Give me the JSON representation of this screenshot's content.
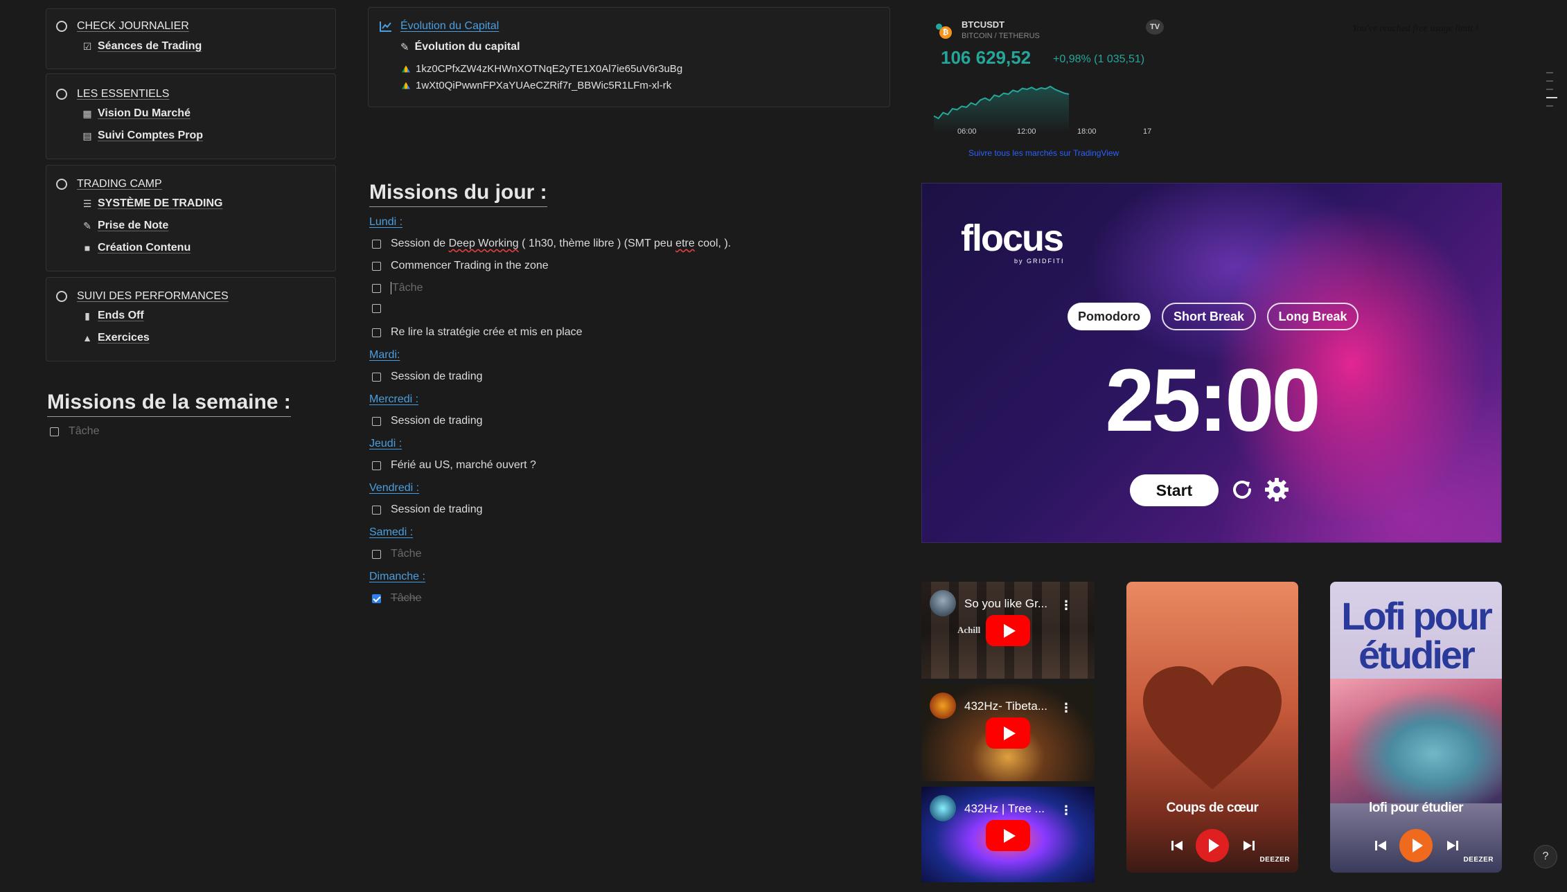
{
  "left_nav": {
    "sections": [
      {
        "title": "CHECK JOURNALIER",
        "items": [
          {
            "icon": "checkbox-icon",
            "label": "Séances de Trading"
          }
        ]
      },
      {
        "title": "LES ESSENTIELS",
        "items": [
          {
            "icon": "calendar-icon",
            "label": "Vision Du Marché"
          },
          {
            "icon": "calculator-icon",
            "label": "Suivi Comptes Prop"
          }
        ]
      },
      {
        "title": "TRADING CAMP",
        "items": [
          {
            "icon": "list-icon",
            "label": "SYSTÈME DE TRADING"
          },
          {
            "icon": "pencil-icon",
            "label": "Prise de Note"
          },
          {
            "icon": "video-icon",
            "label": "Création Contenu"
          }
        ]
      },
      {
        "title": "SUIVI DES PERFORMANCES",
        "items": [
          {
            "icon": "book-icon",
            "label": "Ends Off"
          },
          {
            "icon": "graduation-icon",
            "label": "Exercices"
          }
        ]
      }
    ]
  },
  "weekly": {
    "heading": "Missions de la semaine :",
    "task": "Tâche"
  },
  "capital": {
    "title": "Évolution du Capital",
    "subtitle": "Évolution du capital",
    "files": [
      "1kz0CPfxZW4zKHWnXOTNqE2yTE1X0Al7ie65uV6r3uBg",
      "1wXt0QiPwwnFPXaYUAeCZRif7r_BBWic5R1LFm-xl-rk"
    ]
  },
  "daily": {
    "heading": "Missions du jour :",
    "days": [
      {
        "name": "Lundi :",
        "tasks": [
          {
            "text_a": "Session de ",
            "text_b": "Deep Working",
            "text_c": " ( 1h30, thème libre ) (SMT peu ",
            "text_d": "etre",
            "text_e": " cool, ).",
            "state": "open"
          },
          {
            "text": "Commencer Trading in the zone",
            "state": "open"
          },
          {
            "text": "Tâche",
            "state": "placeholder"
          },
          {
            "text": "",
            "state": "open"
          },
          {
            "text": "Re lire la stratégie crée et mis en place",
            "state": "open"
          }
        ]
      },
      {
        "name": "Mardi:",
        "tasks": [
          {
            "text": "Session de trading",
            "state": "open"
          }
        ]
      },
      {
        "name": "Mercredi :",
        "tasks": [
          {
            "text": "Session de trading",
            "state": "open"
          }
        ]
      },
      {
        "name": "Jeudi :",
        "tasks": [
          {
            "text": "Férié au US, marché ouvert ?",
            "state": "open"
          }
        ]
      },
      {
        "name": "Vendredi :",
        "tasks": [
          {
            "text": "Session de trading",
            "state": "open"
          }
        ]
      },
      {
        "name": "Samedi :",
        "tasks": [
          {
            "text": "Tâche",
            "state": "placeholder"
          }
        ]
      },
      {
        "name": "Dimanche :",
        "tasks": [
          {
            "text": "Tâche",
            "state": "done"
          }
        ]
      }
    ]
  },
  "ticker": {
    "symbol": "BTCUSDT",
    "pair": "BITCOIN / TETHERUS",
    "price": "106 629,52",
    "change": "+0,98% (1 035,51)",
    "time_labels": [
      "06:00",
      "12:00",
      "18:00",
      "17"
    ],
    "link": "Suivre tous les marchés sur TradingView",
    "limit_note": "You've reached free usage limit !",
    "sparkline": [
      0.15,
      0.1,
      0.22,
      0.18,
      0.3,
      0.28,
      0.35,
      0.33,
      0.42,
      0.38,
      0.48,
      0.52,
      0.47,
      0.58,
      0.55,
      0.62,
      0.6,
      0.68,
      0.65,
      0.72,
      0.7,
      0.74,
      0.69,
      0.73,
      0.71,
      0.76,
      0.7,
      0.66,
      0.62,
      0.6
    ],
    "accent": "#26a69a"
  },
  "flocus": {
    "logo": "flocus",
    "byline": "by GRIDFITI",
    "modes": [
      "Pomodoro",
      "Short Break",
      "Long Break"
    ],
    "active_mode": "Pomodoro",
    "timer": "25:00",
    "start": "Start"
  },
  "videos": [
    {
      "title": "So you like Gr...",
      "overlay": "Achill          down"
    },
    {
      "title": "432Hz- Tibeta...",
      "overlay": ""
    },
    {
      "title": "432Hz | Tree ...",
      "overlay": ""
    }
  ],
  "deezer": [
    {
      "title": "Coups de cœur",
      "brand": "DEEZER",
      "accent": "#e84c2a"
    },
    {
      "title": "lofi pour étudier",
      "cover_text": "Lofi pour étudier",
      "brand": "DEEZER",
      "accent": "#f06a1e"
    }
  ]
}
